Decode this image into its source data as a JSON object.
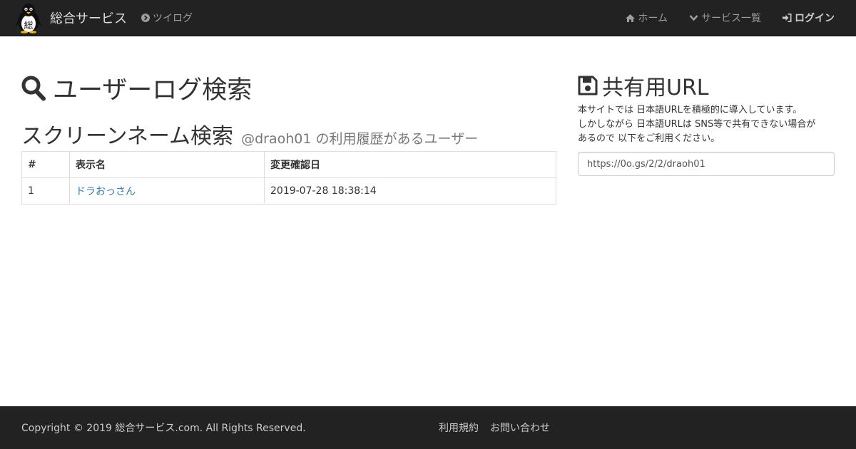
{
  "navbar": {
    "brand": "総合サービス",
    "brand_logo": {
      "glyph": "総",
      "icon": "penguin-logo"
    },
    "left_link": {
      "label": "ツイログ",
      "icon": "chevron-circle-right-icon"
    },
    "right_links": [
      {
        "label": "ホーム",
        "icon": "home-icon"
      },
      {
        "label": "サービス一覧",
        "icon": "chevron-down-icon"
      },
      {
        "label": "ログイン",
        "icon": "sign-in-icon"
      }
    ]
  },
  "main": {
    "title": "ユーザーログ検索",
    "title_icon": "search-icon",
    "subtitle": "スクリーンネーム検索",
    "subtitle_small": "@draoh01 の利用履歴があるユーザー",
    "table": {
      "headers": [
        "#",
        "表示名",
        "変更確認日"
      ],
      "rows": [
        {
          "index": "1",
          "name": "ドラおっさん",
          "date": "2019-07-28 18:38:14"
        }
      ]
    }
  },
  "share": {
    "title": "共有用URL",
    "title_icon": "floppy-disk-icon",
    "description_lines": [
      "本サイトでは 日本語URLを積極的に導入しています。",
      "しかしながら 日本語URLは SNS等で共有できない場合が",
      "あるので 以下をご利用ください。"
    ],
    "url_value": "https://0o.gs/2/2/draoh01"
  },
  "footer": {
    "copyright": "Copyright © 2019 総合サービス.com. All Rights Reserved.",
    "links": [
      "利用規約",
      "お問い合わせ"
    ]
  },
  "colors": {
    "navbar_bg": "#222222",
    "link": "#337ab7",
    "footer_bg": "#222222"
  }
}
